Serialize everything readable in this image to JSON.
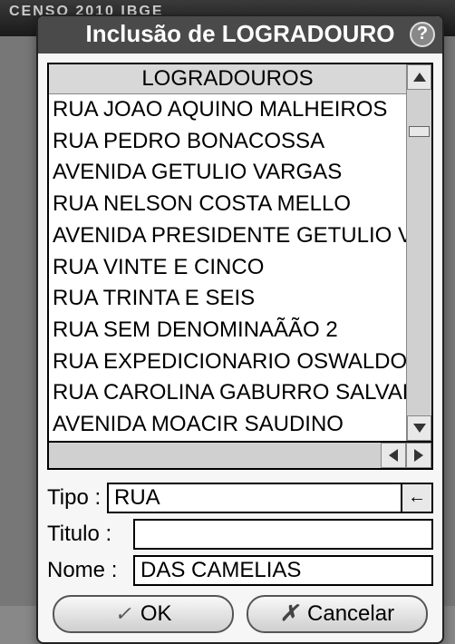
{
  "backdrop": {
    "brand": "CENSO 2010   IBGE"
  },
  "dialog": {
    "title": "Inclusão de LOGRADOURO",
    "help": "?",
    "list_header": "LOGRADOUROS",
    "items": [
      "RUA JOAO AQUINO MALHEIROS",
      "RUA PEDRO BONACOSSA",
      "AVENIDA GETULIO VARGAS",
      "RUA NELSON COSTA MELLO",
      "AVENIDA PRESIDENTE GETULIO V",
      "RUA VINTE E CINCO",
      "RUA TRINTA E SEIS",
      "RUA SEM DENOMINAÃÃO 2",
      "RUA EXPEDICIONARIO OSWALDO",
      "RUA CAROLINA GABURRO SALVAD",
      "AVENIDA MOACIR SAUDINO"
    ],
    "form": {
      "tipo_label": "Tipo :",
      "tipo_value": "RUA",
      "clear_glyph": "←",
      "titulo_label": "Titulo :",
      "titulo_value": "",
      "nome_label": "Nome :",
      "nome_value": "DAS CAMELIAS"
    },
    "buttons": {
      "ok": "OK",
      "cancel": "Cancelar"
    }
  }
}
